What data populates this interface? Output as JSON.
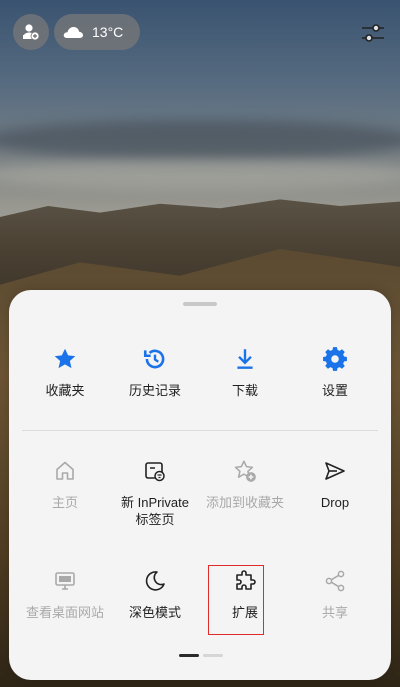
{
  "topbar": {
    "temperature": "13°C",
    "avatar_icon": "person-add-icon",
    "weather_icon": "cloud-icon",
    "settings_icon": "sliders-icon"
  },
  "colors": {
    "accent": "#1a73e8",
    "disabled": "#a9a9a9",
    "text": "#1f1f1f",
    "sheet_bg": "#f4f4f4",
    "highlight": "#e02a2a"
  },
  "menu": {
    "row1": [
      {
        "label": "收藏夹",
        "icon": "star-icon"
      },
      {
        "label": "历史记录",
        "icon": "history-icon"
      },
      {
        "label": "下载",
        "icon": "download-icon"
      },
      {
        "label": "设置",
        "icon": "gear-icon"
      }
    ],
    "row2": [
      {
        "label": "主页",
        "icon": "home-icon",
        "disabled": true
      },
      {
        "label": "新 InPrivate\n标签页",
        "icon": "inprivate-tab-icon",
        "disabled": false
      },
      {
        "label": "添加到收藏夹",
        "icon": "add-favorite-icon",
        "disabled": true
      },
      {
        "label": "Drop",
        "icon": "send-icon",
        "disabled": false
      }
    ],
    "row3": [
      {
        "label": "查看桌面网站",
        "icon": "desktop-icon",
        "disabled": true
      },
      {
        "label": "深色模式",
        "icon": "moon-icon",
        "disabled": false
      },
      {
        "label": "扩展",
        "icon": "puzzle-icon",
        "disabled": false,
        "highlighted": true
      },
      {
        "label": "共享",
        "icon": "share-icon",
        "disabled": true
      }
    ]
  },
  "pager": {
    "pages": 2,
    "current": 1
  }
}
